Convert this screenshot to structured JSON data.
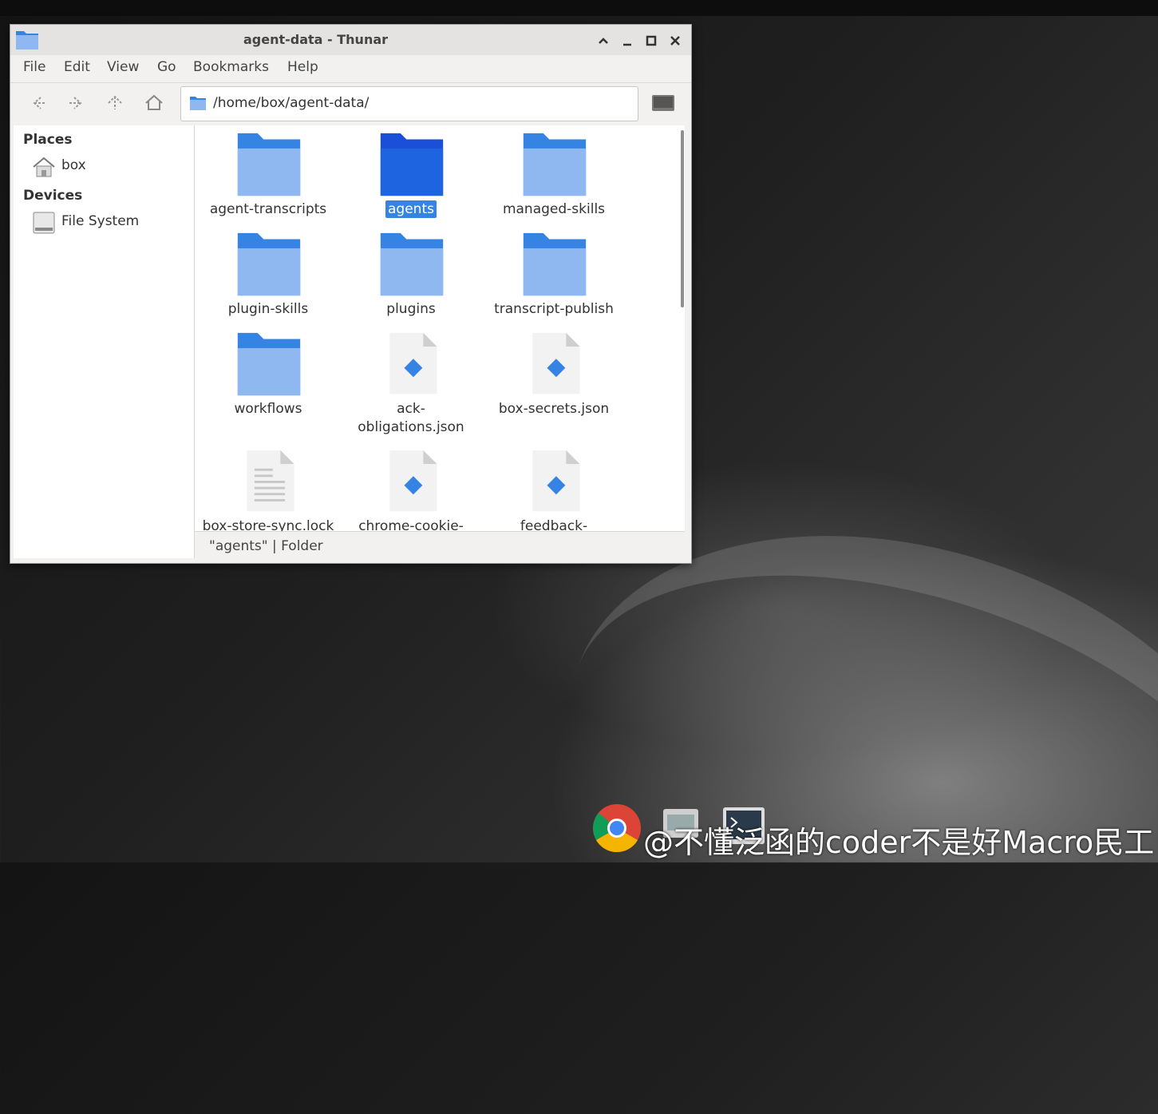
{
  "window": {
    "title": "agent-data - Thunar",
    "controls": [
      "^",
      "_",
      "□",
      "×"
    ]
  },
  "menu": [
    "File",
    "Edit",
    "View",
    "Go",
    "Bookmarks",
    "Help"
  ],
  "toolbar": {
    "location": "/home/box/agent-data/"
  },
  "sidebar": {
    "places_heading": "Places",
    "places": [
      {
        "label": "box",
        "icon": "home-icon"
      }
    ],
    "devices_heading": "Devices",
    "devices": [
      {
        "label": "File System",
        "icon": "drive-icon"
      }
    ]
  },
  "files": [
    {
      "name": "agent-transcripts",
      "type": "folder",
      "selected": false
    },
    {
      "name": "agents",
      "type": "folder",
      "selected": true
    },
    {
      "name": "managed-skills",
      "type": "folder",
      "selected": false
    },
    {
      "name": "plugin-skills",
      "type": "folder",
      "selected": false
    },
    {
      "name": "plugins",
      "type": "folder",
      "selected": false
    },
    {
      "name": "transcript-publish",
      "type": "folder",
      "selected": false
    },
    {
      "name": "workflows",
      "type": "folder",
      "selected": false
    },
    {
      "name": "ack-obligations.json",
      "type": "json",
      "selected": false
    },
    {
      "name": "box-secrets.json",
      "type": "json",
      "selected": false
    },
    {
      "name": "box-store-sync.lock",
      "type": "text",
      "selected": false
    },
    {
      "name": "chrome-cookie-",
      "type": "json",
      "selected": false
    },
    {
      "name": "feedback-",
      "type": "json",
      "selected": false
    }
  ],
  "status": "\"agents\"  |  Folder",
  "watermark": "@不懂泛函的coder不是好Macro民工",
  "colors": {
    "selection": "#3584e4",
    "folder_light": "#8fb8f0",
    "folder_dark": "#3584e4",
    "json_diamond": "#3584e4"
  }
}
